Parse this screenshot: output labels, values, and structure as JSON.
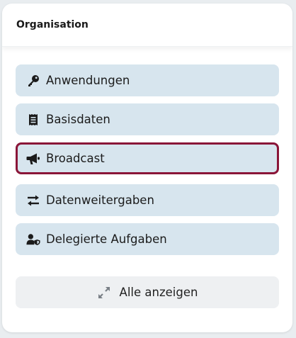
{
  "header": {
    "title": "Organisation"
  },
  "nav": {
    "items": [
      {
        "label": "Anwendungen",
        "icon": "key-icon",
        "active": false
      },
      {
        "label": "Basisdaten",
        "icon": "receipt-icon",
        "active": false
      },
      {
        "label": "Broadcast",
        "icon": "megaphone-icon",
        "active": true
      },
      {
        "label": "Datenweitergaben",
        "icon": "exchange-arrows-icon",
        "active": false
      },
      {
        "label": "Delegierte Aufgaben",
        "icon": "user-shield-icon",
        "active": false
      }
    ]
  },
  "show_all": {
    "label": "Alle anzeigen",
    "icon": "expand-arrows-icon"
  },
  "colors": {
    "item_bg": "#d7e5ee",
    "active_border": "#8a1538",
    "show_all_bg": "#eef0f2",
    "icon_muted": "#7a8087"
  }
}
